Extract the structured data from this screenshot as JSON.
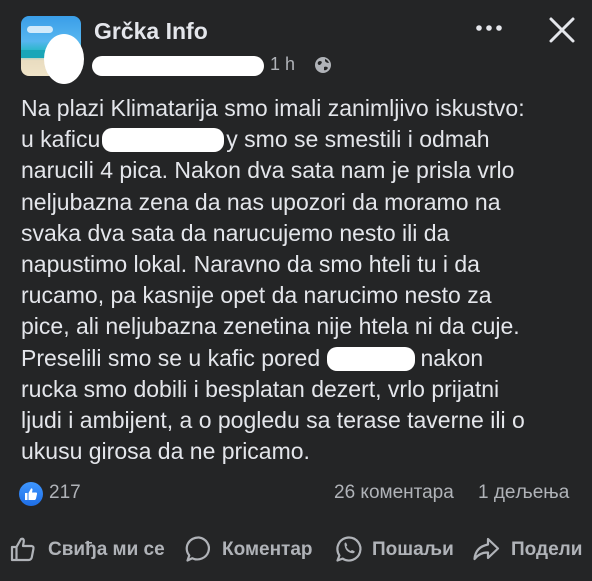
{
  "header": {
    "page_name": "Grčka Info",
    "time": "1 h",
    "more_icon": "more-horizontal-icon",
    "close_icon": "close-icon",
    "audience_icon": "globe-icon"
  },
  "post": {
    "l1": "Na plazi Klimatarija smo imali zanimljivo iskustvo:",
    "l2a": "u kaficu",
    "l2b": "y smo se smestili i odmah",
    "l3": "narucili 4 pica. Nakon dva sata nam je prisla vrlo",
    "l4": "neljubazna zena da nas upozori da moramo na",
    "l5": "svaka dva sata da narucujemo nesto ili da",
    "l6": "napustimo lokal. Naravno da smo hteli tu i da",
    "l7": "rucamo, pa kasnije opet da narucimo nesto za",
    "l8": "pice, ali neljubazna zenetina nije htela ni da cuje.",
    "l9a": "Preselili smo se u kafic pored",
    "l9b": "nakon",
    "l10": "rucka smo dobili i besplatan dezert, vrlo prijatni",
    "l11": "ljudi i ambijent, a o pogledu sa terase taverne ili o",
    "l12": "ukusu girosa da ne pricamo."
  },
  "stats": {
    "likes": "217",
    "comments": "26 коментара",
    "shares": "1 дељења"
  },
  "actions": {
    "like": "Свиђа ми се",
    "comment": "Коментар",
    "send": "Пошаљи",
    "share": "Подели"
  },
  "colors": {
    "background": "#242526",
    "text_primary": "#e4e6eb",
    "text_secondary": "#b0b3b8",
    "like_blue": "#1877f2"
  }
}
